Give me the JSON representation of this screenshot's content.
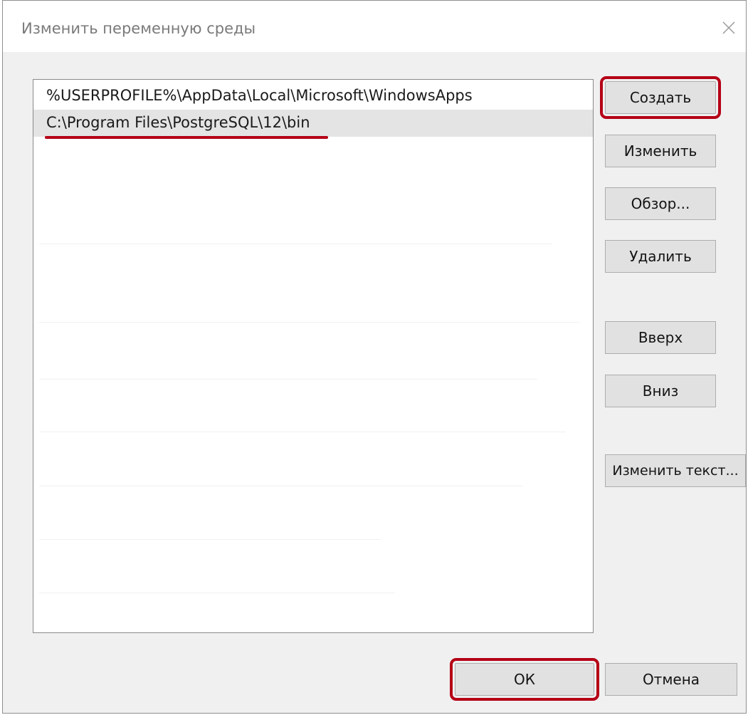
{
  "window": {
    "title": "Изменить переменную среды",
    "close_icon": "close-icon"
  },
  "path_list": {
    "items": [
      "%USERPROFILE%\\AppData\\Local\\Microsoft\\WindowsApps",
      "C:\\Program Files\\PostgreSQL\\12\\bin"
    ],
    "selected_index": 1
  },
  "buttons": {
    "create": "Создать",
    "edit": "Изменить",
    "browse": "Обзор...",
    "delete": "Удалить",
    "up": "Вверх",
    "down": "Вниз",
    "edit_text": "Изменить текст...",
    "ok": "ОК",
    "cancel": "Отмена"
  },
  "colors": {
    "dialog_background": "#f0f0f0",
    "highlight_annotation": "#b50016",
    "selected_row": "#e4e4e4",
    "button_face": "#e1e1e1"
  }
}
